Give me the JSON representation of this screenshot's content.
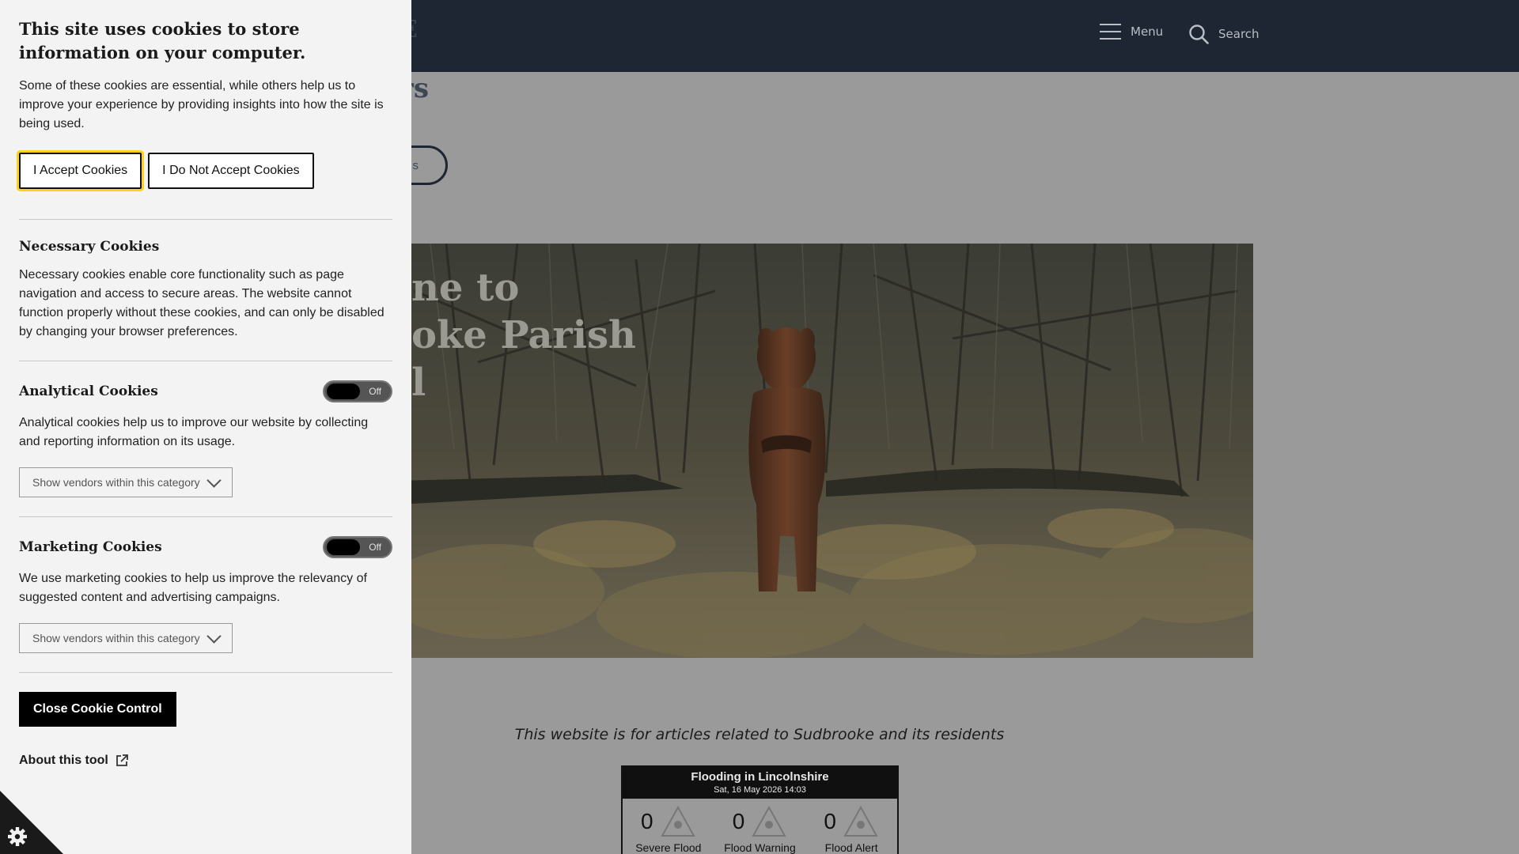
{
  "site": {
    "logo_text": "E",
    "menu_label": "Menu",
    "search_label": "Search",
    "heading_partial": "rs",
    "pill_partial": "s",
    "hero_title": "ne to\noke Parish\nl",
    "tagline": "This website is for articles related to Sudbrooke and its residents"
  },
  "flood_widget": {
    "title": "Flooding in Lincolnshire",
    "date": "Sat, 16 May 2026 14:03",
    "items": [
      {
        "count": "0",
        "label": "Severe Flood Warning"
      },
      {
        "count": "0",
        "label": "Flood Warning"
      },
      {
        "count": "0",
        "label": "Flood Alert"
      }
    ]
  },
  "cookie": {
    "title": "This site uses cookies to store information on your computer.",
    "intro": "Some of these cookies are essential, while others help us to improve your experience by providing insights into how the site is being used.",
    "accept_label": "I Accept Cookies",
    "reject_label": "I Do Not Accept Cookies",
    "sections": {
      "necessary": {
        "title": "Necessary Cookies",
        "text": "Necessary cookies enable core functionality such as page navigation and access to secure areas. The website cannot function properly without these cookies, and can only be disabled by changing your browser preferences."
      },
      "analytical": {
        "title": "Analytical Cookies",
        "toggle": "Off",
        "text": "Analytical cookies help us to improve our website by collecting and reporting information on its usage.",
        "vendors": "Show vendors within this category"
      },
      "marketing": {
        "title": "Marketing Cookies",
        "toggle": "Off",
        "text": "We use marketing cookies to help us improve the relevancy of suggested content and advertising campaigns.",
        "vendors": "Show vendors within this category"
      }
    },
    "close_label": "Close Cookie Control",
    "about_label": "About this tool"
  },
  "colors": {
    "header_bg": "#1d2632",
    "panel_bg": "#f3f3f3",
    "focus_ring": "#ffd11a",
    "overlay_bg": "#9a9a9a"
  },
  "icons": [
    "hamburger-icon",
    "search-icon",
    "chevron-down-icon",
    "external-link-icon",
    "cookie-gear-icon",
    "warning-triangle-icon"
  ]
}
